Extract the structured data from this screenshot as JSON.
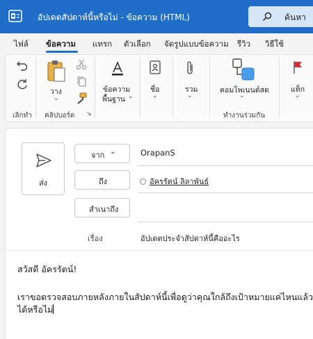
{
  "window": {
    "title": "อัปเดตสัปดาห์นี้หรือไม่ - ข้อความ (HTML)",
    "search_label": "ค้นหา"
  },
  "tabs": [
    "ไฟล์",
    "ข้อความ",
    "แทรก",
    "ตัวเลือก",
    "จัดรูปแบบข้อความ",
    "รีวิว",
    "วิธีใช้"
  ],
  "ribbon": {
    "groups": {
      "undo": "เลิกทำ",
      "clipboard": "คลิปบอร์ด",
      "apps": "ทำงานร่วมกัน"
    },
    "paste_label": "วาง",
    "basic_text_label_1": "ข้อความ",
    "basic_text_label_2": "พื้นฐาน",
    "names_label": "ชื่อ",
    "include_label": "รวม",
    "loop_label": "คอมโพเนนต์สด",
    "tags_label": "แท็ก"
  },
  "compose": {
    "send_label": "ส่ง",
    "from_label": "จาก",
    "from_value": "OrapanS",
    "to_label": "ถึง",
    "to_value": "อัครรัตน์ ลิลาพันธ์",
    "cc_label": "สำเนาถึง",
    "subject_label": "เรื่อง",
    "subject_value": "อัปเดตประจำสัปดาห์นี้คืออะไร",
    "body_line_1": "สวัสดี อัครรัตน์!",
    "body_line_2": "เราขอตรวจสอบภายหลังภายในสัปดาห์นี้เพื่อดูว่าคุณใกล้ถึงเป้าหมายแค่ไหนแล้ว",
    "body_line_3": "ได้หรือไม่"
  },
  "colors": {
    "titlebar": "#1f6ec8",
    "accent": "#1f6ec8"
  }
}
